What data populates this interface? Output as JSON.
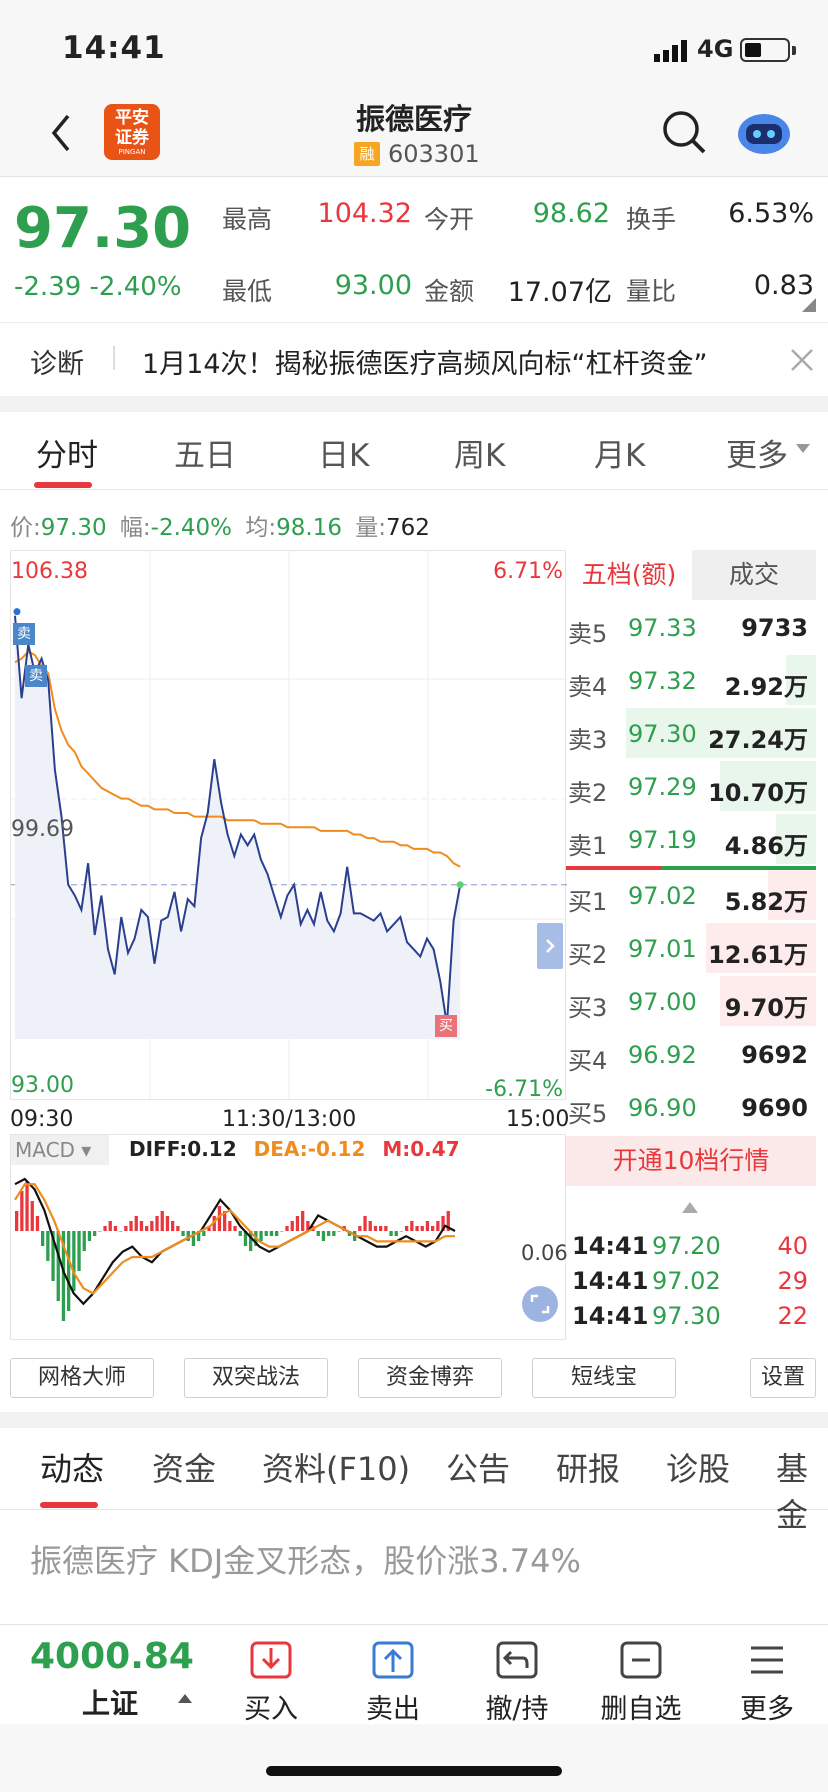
{
  "status": {
    "time": "14:41",
    "network": "4G"
  },
  "nav": {
    "title": "振德医疗",
    "rong": "融",
    "code": "603301",
    "logo_line1": "平安",
    "logo_line2": "证券",
    "logo_small": "PINGAN"
  },
  "quote": {
    "price": "97.30",
    "change": "-2.39",
    "pct": "-2.40%",
    "high_l": "最高",
    "high": "104.32",
    "open_l": "今开",
    "open": "98.62",
    "turn_l": "换手",
    "turn": "6.53%",
    "low_l": "最低",
    "low": "93.00",
    "amt_l": "金额",
    "amt": "17.07亿",
    "vr_l": "量比",
    "vr": "0.83"
  },
  "diag": {
    "label": "诊断",
    "text": "1月14次！揭秘振德医疗高频风向标“杠杆资金”"
  },
  "tabs": [
    "分时",
    "五日",
    "日K",
    "周K",
    "月K",
    "更多"
  ],
  "info": {
    "p_l": "价:",
    "p": "97.30",
    "f_l": "幅:",
    "f": "-2.40%",
    "a_l": "均:",
    "a": "98.16",
    "v_l": "量:",
    "v": "762"
  },
  "chart_labels": {
    "ymax": "106.38",
    "ymid": "99.69",
    "ymin": "93.00",
    "pmax": "6.71%",
    "pmin": "-6.71%",
    "t0": "09:30",
    "t1": "11:30/13:00",
    "t2": "15:00",
    "sell": "卖",
    "buy": "买"
  },
  "chart_data": {
    "type": "line",
    "x_range": [
      "09:30",
      "15:00"
    ],
    "ylim": [
      93.0,
      106.38
    ],
    "price": [
      104.8,
      102.5,
      104.0,
      103.2,
      103.6,
      103.0,
      100.5,
      99.2,
      97.3,
      97.0,
      96.6,
      97.9,
      95.9,
      97.0,
      95.5,
      94.8,
      96.4,
      95.4,
      95.8,
      96.6,
      96.4,
      95.1,
      96.3,
      96.4,
      97.1,
      96.0,
      96.9,
      96.7,
      98.6,
      99.3,
      100.8,
      99.6,
      98.7,
      98.1,
      98.7,
      98.4,
      98.7,
      98.0,
      97.6,
      97.0,
      96.4,
      97.0,
      97.3,
      96.2,
      96.6,
      96.2,
      97.1,
      96.3,
      96.0,
      96.5,
      97.8,
      96.5,
      96.5,
      96.4,
      96.3,
      96.5,
      96.0,
      96.2,
      96.4,
      95.7,
      95.5,
      95.3,
      95.8,
      95.5,
      94.6,
      93.4,
      96.3,
      97.3
    ],
    "avg": [
      103.5,
      103.6,
      103.8,
      103.7,
      103.4,
      103.2,
      102.2,
      101.6,
      101.2,
      101.0,
      100.6,
      100.4,
      100.2,
      100.0,
      99.9,
      99.8,
      99.7,
      99.7,
      99.6,
      99.5,
      99.5,
      99.4,
      99.4,
      99.4,
      99.3,
      99.3,
      99.3,
      99.2,
      99.2,
      99.2,
      99.2,
      99.2,
      99.1,
      99.1,
      99.1,
      99.1,
      99.1,
      99.0,
      99.0,
      99.0,
      99.0,
      98.9,
      98.9,
      98.9,
      98.9,
      98.9,
      98.8,
      98.8,
      98.8,
      98.8,
      98.8,
      98.7,
      98.7,
      98.6,
      98.6,
      98.5,
      98.5,
      98.5,
      98.4,
      98.4,
      98.3,
      98.3,
      98.3,
      98.2,
      98.2,
      98.1,
      97.9,
      97.8
    ],
    "prev_close": 99.69
  },
  "macd": {
    "label": "MACD",
    "diff_l": "DIFF:",
    "diff": "0.12",
    "dea_l": "DEA:",
    "dea": "-0.12",
    "m_l": "M:",
    "m": "0.47",
    "scale": "0.06",
    "bars": [
      4,
      8,
      10,
      6,
      3,
      -3,
      -6,
      -10,
      -14,
      -18,
      -16,
      -12,
      -8,
      -4,
      -2,
      -1,
      0,
      1,
      2,
      1,
      0,
      1,
      2,
      3,
      2,
      1,
      2,
      3,
      4,
      3,
      2,
      1,
      -1,
      -2,
      -3,
      -2,
      -1,
      1,
      3,
      5,
      4,
      2,
      1,
      -1,
      -3,
      -4,
      -3,
      -2,
      -1,
      -1,
      -1,
      0,
      1,
      2,
      3,
      4,
      2,
      1,
      -1,
      -2,
      -1,
      -1,
      0,
      1,
      -1,
      -2,
      1,
      3,
      2,
      1,
      1,
      1,
      -1,
      -1,
      0,
      1,
      2,
      1,
      1,
      2,
      1,
      2,
      3,
      4
    ],
    "diff_series": [
      9,
      10,
      8,
      4,
      -2,
      -8,
      -12,
      -14,
      -12,
      -9,
      -6,
      -4,
      -3,
      -5,
      -6,
      -4,
      -3,
      -2,
      -1,
      0,
      3,
      6,
      4,
      1,
      -1,
      -3,
      -4,
      -3,
      -2,
      -1,
      0,
      3,
      2,
      1,
      0,
      -1,
      -2,
      -3,
      -3,
      -2,
      -1,
      -2,
      -3,
      -2,
      1,
      0
    ],
    "dea_series": [
      6,
      9,
      9,
      6,
      2,
      -3,
      -8,
      -11,
      -12,
      -10,
      -8,
      -6,
      -5,
      -5,
      -5,
      -4,
      -3,
      -2,
      -1,
      0,
      1,
      3,
      4,
      2,
      0,
      -2,
      -3,
      -3,
      -2,
      -1,
      0,
      1,
      2,
      1,
      0,
      -1,
      -1,
      -2,
      -2,
      -2,
      -2,
      -2,
      -2,
      -2,
      -1,
      -1
    ]
  },
  "orderbook": {
    "tab1": "五档(额)",
    "tab2": "成交",
    "sells": [
      {
        "l": "卖5",
        "p": "97.33",
        "v": "9733"
      },
      {
        "l": "卖4",
        "p": "97.32",
        "v": "2.92万"
      },
      {
        "l": "卖3",
        "p": "97.30",
        "v": "27.24万"
      },
      {
        "l": "卖2",
        "p": "97.29",
        "v": "10.70万"
      },
      {
        "l": "卖1",
        "p": "97.19",
        "v": "4.86万"
      }
    ],
    "buys": [
      {
        "l": "买1",
        "p": "97.02",
        "v": "5.82万"
      },
      {
        "l": "买2",
        "p": "97.01",
        "v": "12.61万"
      },
      {
        "l": "买3",
        "p": "97.00",
        "v": "9.70万"
      },
      {
        "l": "买4",
        "p": "96.92",
        "v": "9692"
      },
      {
        "l": "买5",
        "p": "96.90",
        "v": "9690"
      }
    ],
    "open10": "开通10档行情",
    "ticks": [
      {
        "t": "14:41",
        "p": "97.20",
        "v": "40"
      },
      {
        "t": "14:41",
        "p": "97.02",
        "v": "29"
      },
      {
        "t": "14:41",
        "p": "97.30",
        "v": "22"
      }
    ]
  },
  "tools": [
    "网格大师",
    "双突战法",
    "资金博弈",
    "短线宝",
    "设置"
  ],
  "bottom_tabs": [
    "动态",
    "资金",
    "资料(F10)",
    "公告",
    "研报",
    "诊股",
    "基金"
  ],
  "news": "振德医疗 KDJ金叉形态，股价涨3.74%",
  "bottombar": {
    "index_val": "4000.84",
    "index_name": "上证",
    "buy": "买入",
    "sell": "卖出",
    "cancel": "撤/持",
    "del": "删自选",
    "more": "更多"
  },
  "colors": {
    "up": "#e8383d",
    "down": "#2e9e4f",
    "price_line": "#2b3f8f",
    "avg_line": "#f08c1e"
  }
}
